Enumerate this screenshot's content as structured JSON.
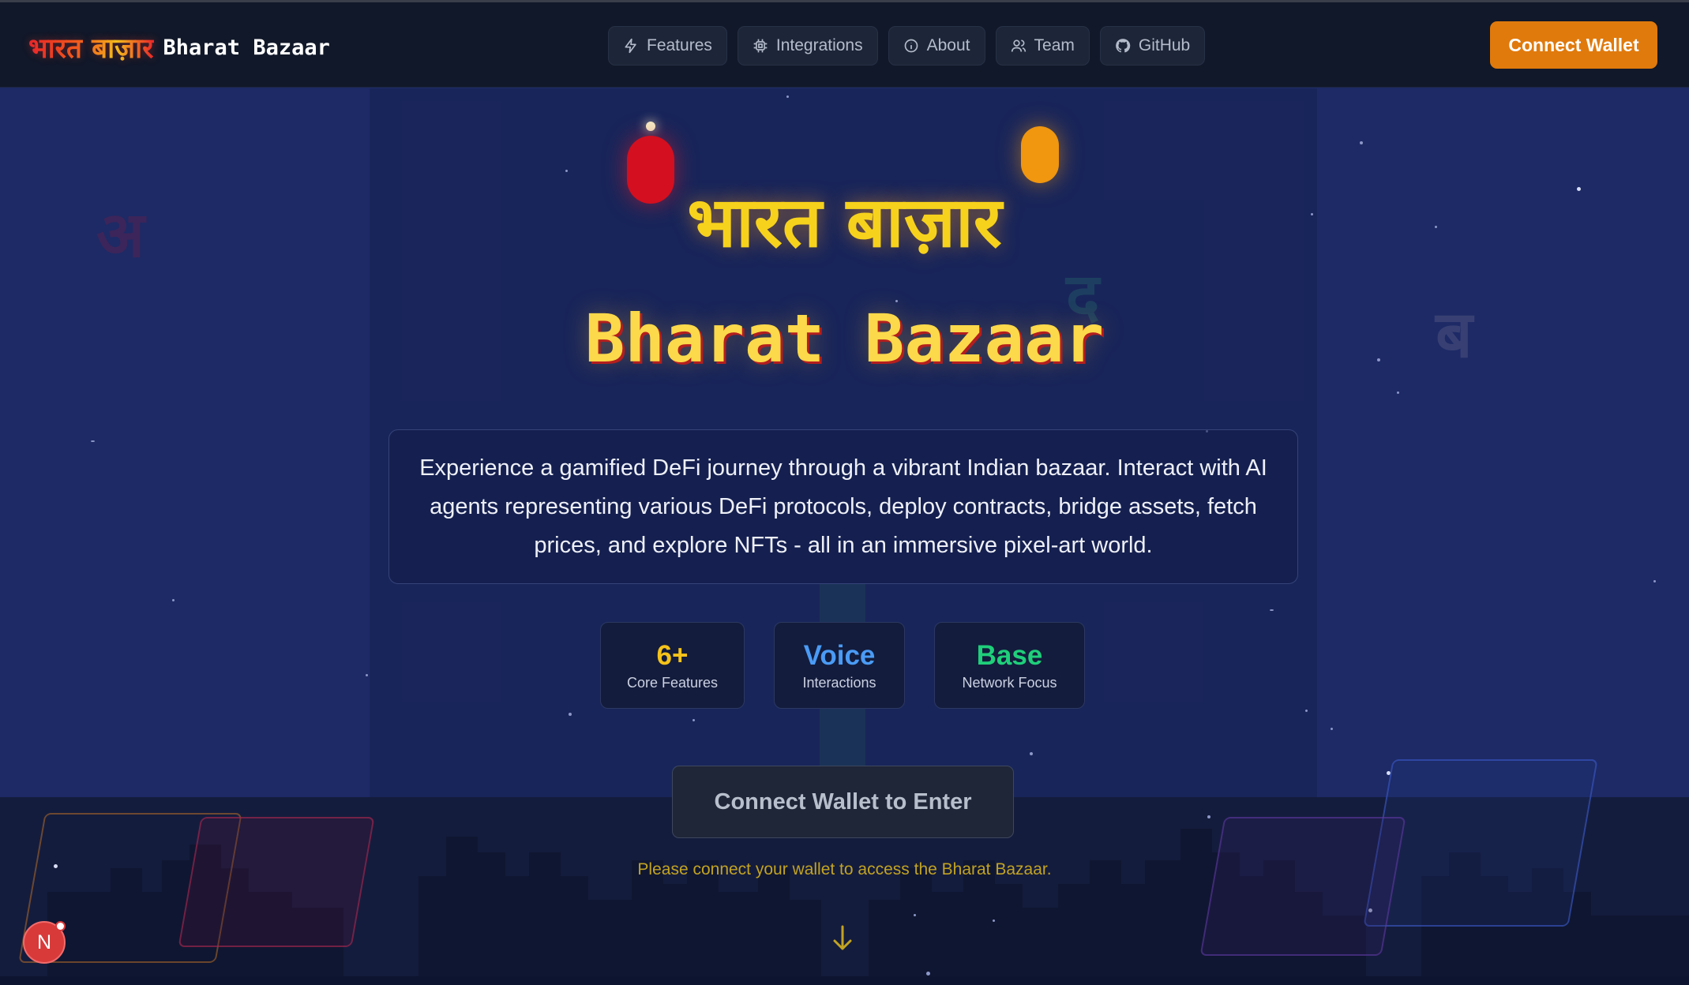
{
  "nav": {
    "brand_hindi": "भारत बाज़ार",
    "brand_en": "Bharat Bazaar",
    "links": [
      {
        "label": "Features",
        "icon": "lightning-icon"
      },
      {
        "label": "Integrations",
        "icon": "chip-icon"
      },
      {
        "label": "About",
        "icon": "info-icon"
      },
      {
        "label": "Team",
        "icon": "users-icon"
      },
      {
        "label": "GitHub",
        "icon": "github-icon"
      }
    ],
    "connect_label": "Connect Wallet"
  },
  "hero": {
    "title_hindi": "भारत बाज़ार",
    "title_en": "Bharat Bazaar",
    "description": "Experience a gamified DeFi journey through a vibrant Indian bazaar. Interact with AI agents representing various DeFi protocols, deploy contracts, bridge assets, fetch prices, and explore NFTs - all in an immersive pixel-art world."
  },
  "stats": [
    {
      "value": "6+",
      "label": "Core Features",
      "color": "#f4c21a"
    },
    {
      "value": "Voice",
      "label": "Interactions",
      "color": "#4a9bf5"
    },
    {
      "value": "Base",
      "label": "Network Focus",
      "color": "#1fcf7a"
    }
  ],
  "enter": {
    "button_label": "Connect Wallet to Enter",
    "note": "Please connect your wallet to access the Bharat Bazaar."
  },
  "decor": {
    "letters": [
      "अ",
      "द",
      "ब"
    ]
  },
  "dev_badge": {
    "label": "N"
  },
  "colors": {
    "accent": "#e07a0c",
    "background": "#1d2a66",
    "navbar": "#111829",
    "title_yellow": "#f7d21c"
  }
}
